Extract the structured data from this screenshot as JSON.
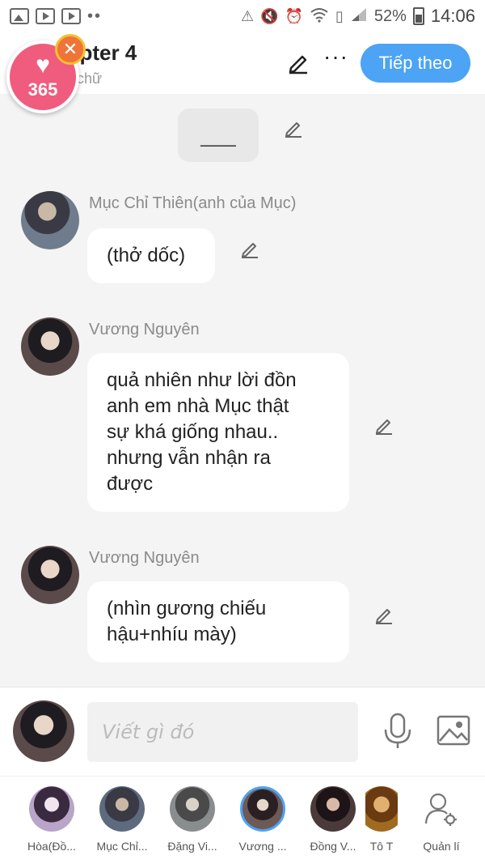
{
  "status_bar": {
    "battery_percent": "52%",
    "time": "14:06"
  },
  "header": {
    "title": "apter 4",
    "word_count": ") chữ",
    "next_label": "Tiếp theo"
  },
  "badge": {
    "count": "365"
  },
  "narration": {
    "text": "___"
  },
  "messages": [
    {
      "sender": "Mục Chỉ Thiên(anh của Mục)",
      "text": "(thở dốc)"
    },
    {
      "sender": "Vương Nguyên",
      "lines": [
        "quả nhiên như lời đồn",
        "anh em nhà Mục thật",
        "sự khá giống nhau..",
        "nhưng vẫn nhận ra",
        "được"
      ]
    },
    {
      "sender": "Vương Nguyên",
      "lines": [
        "(nhìn gương chiếu",
        "hậu+nhíu mày)"
      ]
    }
  ],
  "input": {
    "placeholder": "Viết gì đó"
  },
  "characters": [
    {
      "label": "Hòa(Đồ...",
      "color": "#b8a5c8"
    },
    {
      "label": "Mục Chỉ...",
      "color": "#5e6a7d"
    },
    {
      "label": "Đặng Vi...",
      "color": "#7c7f80"
    },
    {
      "label": "Vương ...",
      "color": "#6d5a56"
    },
    {
      "label": "Đồng V...",
      "color": "#4a3a3a"
    },
    {
      "label": "Tô T",
      "color": "#a06a20"
    },
    {
      "label": "Quản lí"
    }
  ]
}
